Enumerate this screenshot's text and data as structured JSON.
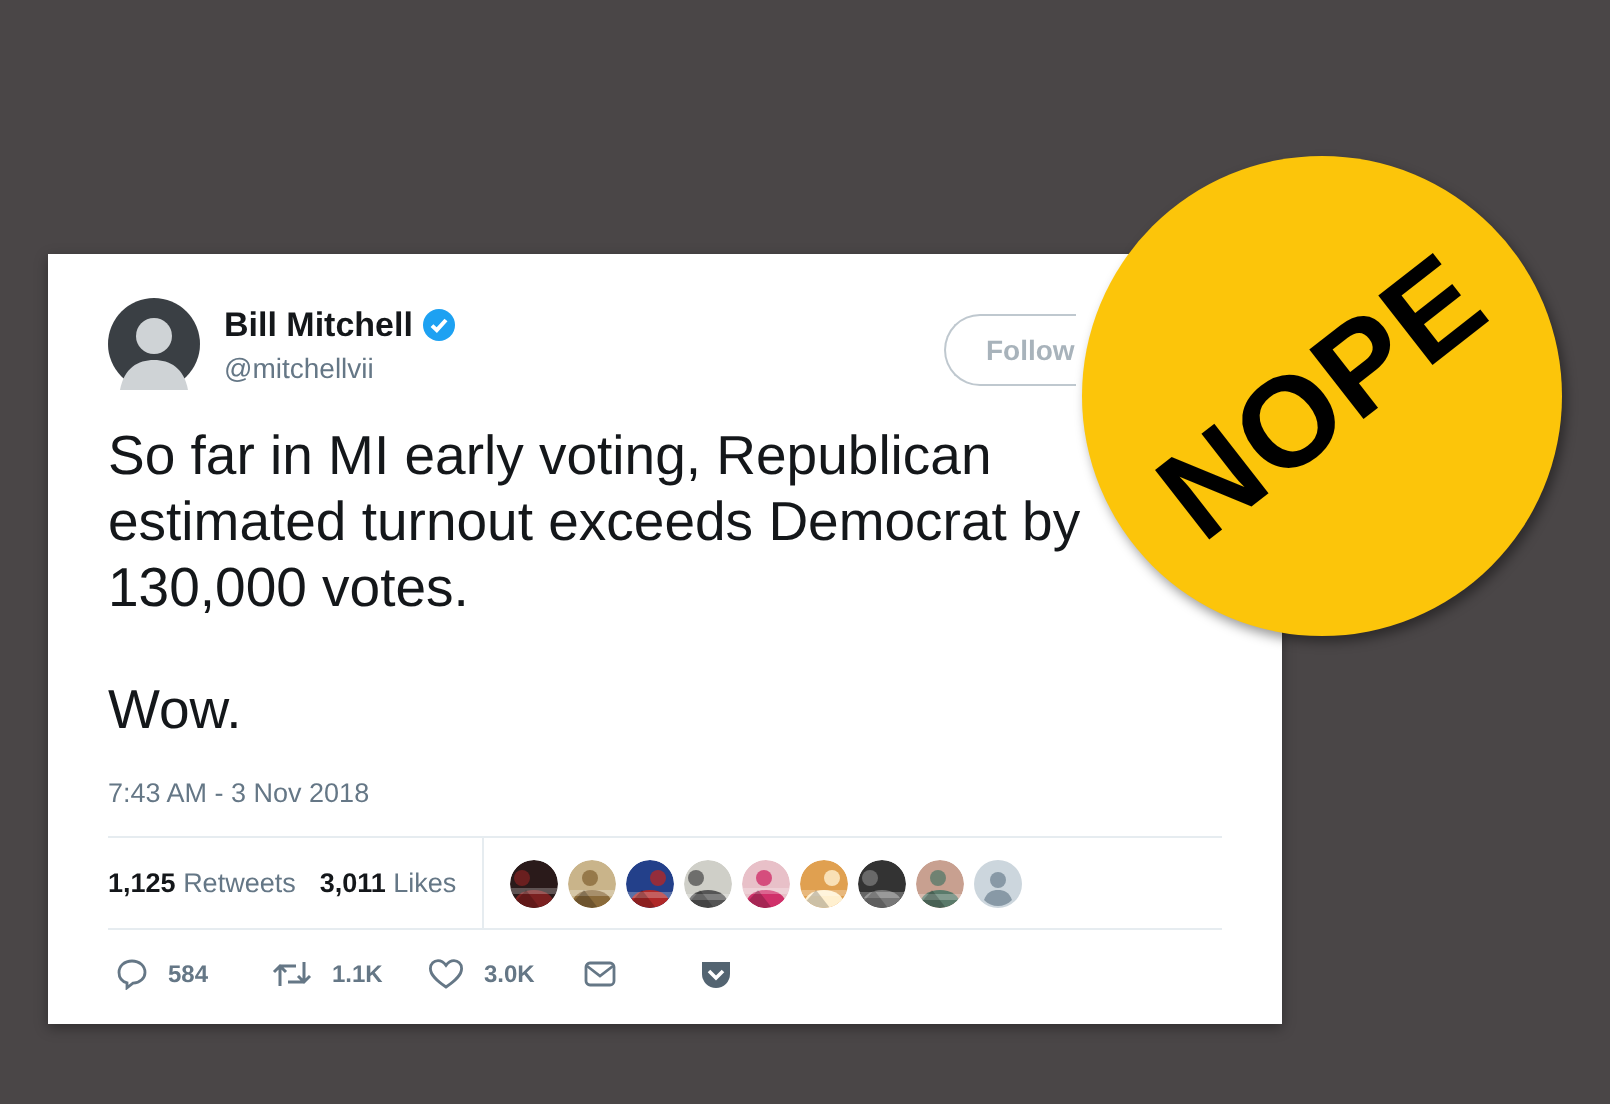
{
  "tweet": {
    "author": {
      "name": "Bill Mitchell",
      "handle": "@mitchellvii",
      "verified": true
    },
    "follow_button": "Follow",
    "paragraphs": [
      "So far in MI early voting, Republican estimated turnout exceeds Democrat by 130,000 votes.",
      "Wow."
    ],
    "timestamp": "7:43 AM - 3 Nov 2018",
    "stats": [
      {
        "count": "1,125",
        "label": "Retweets"
      },
      {
        "count": "3,011",
        "label": "Likes"
      }
    ],
    "likers": [
      {
        "kind": "picture"
      },
      {
        "kind": "picture"
      },
      {
        "kind": "picture"
      },
      {
        "kind": "picture"
      },
      {
        "kind": "picture"
      },
      {
        "kind": "picture"
      },
      {
        "kind": "picture"
      },
      {
        "kind": "picture"
      },
      {
        "kind": "default"
      }
    ],
    "actions": [
      {
        "kind": "reply",
        "count": "584"
      },
      {
        "kind": "retweet",
        "count": "1.1K"
      },
      {
        "kind": "like",
        "count": "3.0K"
      },
      {
        "kind": "message"
      },
      {
        "kind": "pocket"
      }
    ]
  },
  "sticker": {
    "text": "NOPE"
  }
}
